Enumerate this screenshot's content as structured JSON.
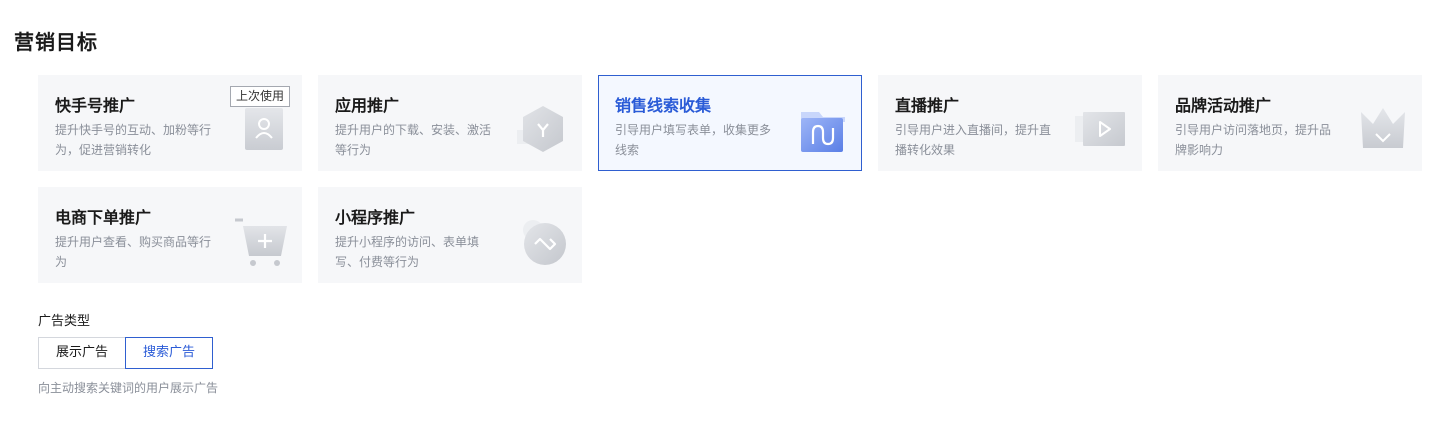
{
  "section": {
    "title": "营销目标"
  },
  "badge_label": "上次使用",
  "cards": [
    {
      "title": "快手号推广",
      "desc": "提升快手号的互动、加粉等行为，促进营销转化",
      "icon": "user-profile-icon"
    },
    {
      "title": "应用推广",
      "desc": "提升用户的下载、安装、激活等行为",
      "icon": "app-hexagon-icon"
    },
    {
      "title": "销售线索收集",
      "desc": "引导用户填写表单，收集更多线索",
      "icon": "folder-lead-icon",
      "selected": true
    },
    {
      "title": "直播推广",
      "desc": "引导用户进入直播间，提升直播转化效果",
      "icon": "live-play-icon"
    },
    {
      "title": "品牌活动推广",
      "desc": "引导用户访问落地页，提升品牌影响力",
      "icon": "crown-icon"
    },
    {
      "title": "电商下单推广",
      "desc": "提升用户查看、购买商品等行为",
      "icon": "shopping-cart-icon"
    },
    {
      "title": "小程序推广",
      "desc": "提升小程序的访问、表单填写、付费等行为",
      "icon": "mini-program-icon"
    }
  ],
  "ad_type": {
    "label": "广告类型",
    "options": [
      "展示广告",
      "搜索广告"
    ],
    "selected": "搜索广告",
    "help": "向主动搜索关键词的用户展示广告"
  },
  "colors": {
    "accent": "#2f5fd0",
    "card_bg": "#f6f7f9",
    "muted_text": "#8a8f99"
  }
}
